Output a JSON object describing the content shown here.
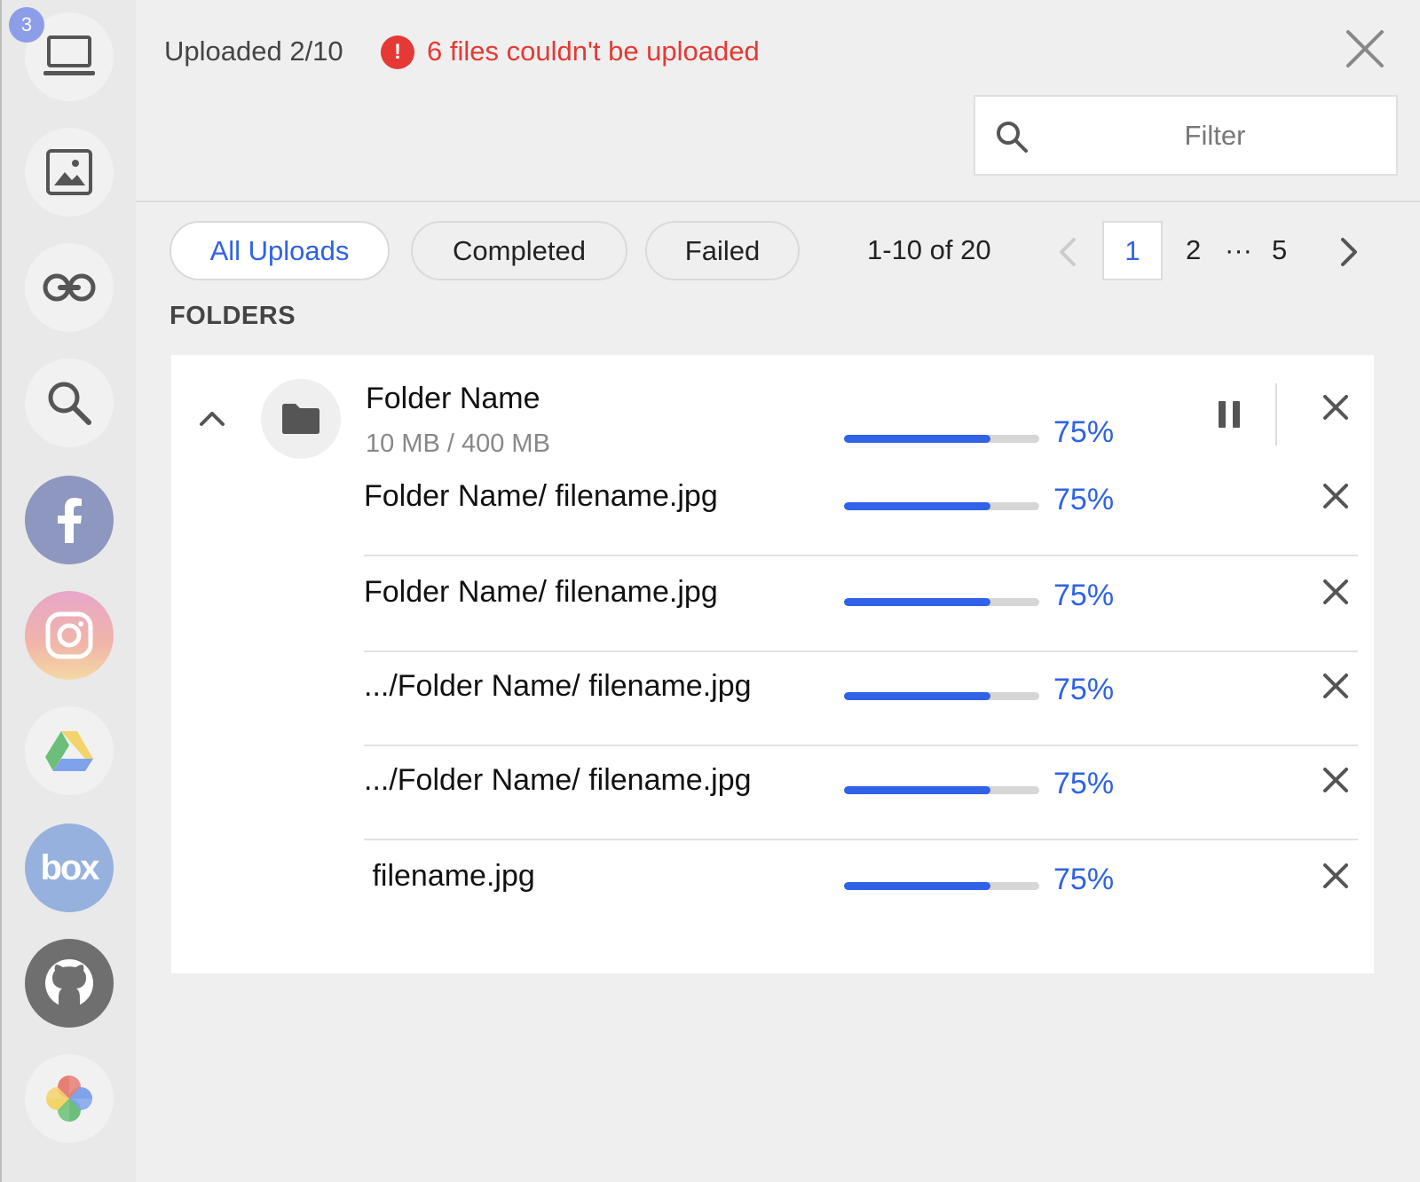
{
  "sidebar": {
    "badge_count": "3",
    "sources": [
      {
        "name": "my-device",
        "icon": "laptop-icon"
      },
      {
        "name": "images",
        "icon": "image-icon"
      },
      {
        "name": "link",
        "icon": "link-icon"
      },
      {
        "name": "image-search",
        "icon": "search-icon"
      },
      {
        "name": "facebook",
        "icon": "facebook-icon",
        "color": "#8d97bf"
      },
      {
        "name": "instagram",
        "icon": "instagram-icon"
      },
      {
        "name": "google-drive",
        "icon": "google-drive-icon"
      },
      {
        "name": "box",
        "icon": "box-icon",
        "color": "#96b1de"
      },
      {
        "name": "github",
        "icon": "github-icon",
        "color": "#6f6f6f"
      },
      {
        "name": "google-photos",
        "icon": "google-photos-icon"
      }
    ],
    "box_label": "box"
  },
  "header": {
    "uploaded": "Uploaded 2/10",
    "error_text": "6 files couldn't be uploaded",
    "error_icon_glyph": "!",
    "filter_placeholder": "Filter"
  },
  "tabs": [
    {
      "label": "All Uploads",
      "active": true
    },
    {
      "label": "Completed",
      "active": false
    },
    {
      "label": "Failed",
      "active": false
    }
  ],
  "pagination": {
    "range": "1-10 of 20",
    "pages": [
      "1",
      "2",
      "···",
      "5"
    ],
    "current": "1"
  },
  "section_label": "FOLDERS",
  "folder": {
    "name": "Folder Name",
    "size": "10 MB / 400 MB",
    "progress": 0.75,
    "percent": "75%",
    "files": [
      {
        "name": "Folder Name/ filename.jpg",
        "progress": 0.75,
        "percent": "75%"
      },
      {
        "name": "Folder Name/ filename.jpg",
        "progress": 0.75,
        "percent": "75%"
      },
      {
        "name": ".../Folder Name/ filename.jpg",
        "progress": 0.75,
        "percent": "75%"
      },
      {
        "name": ".../Folder Name/ filename.jpg",
        "progress": 0.75,
        "percent": "75%"
      },
      {
        "name": " filename.jpg",
        "progress": 0.75,
        "percent": "75%"
      }
    ]
  },
  "colors": {
    "accent": "#2f62e6",
    "error": "#e53935"
  }
}
